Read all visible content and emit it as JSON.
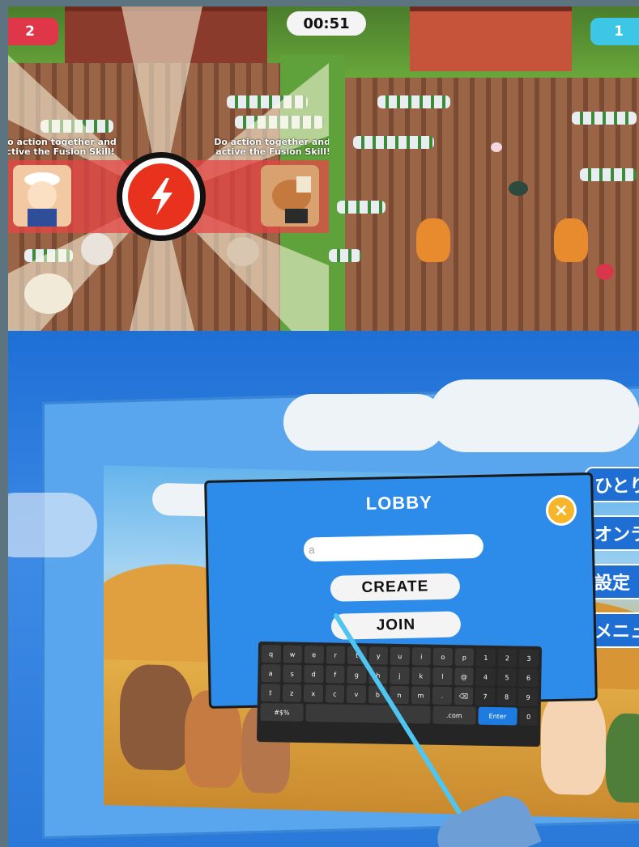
{
  "game": {
    "score_left": "2",
    "score_right": "1",
    "timer": "00:51",
    "fusion_hint_left": "Do action together and active the Fusion Skill!",
    "fusion_hint_right": "Do action together and active the Fusion Skill!",
    "colors": {
      "team_left": "#e0364a",
      "team_right": "#3ec6e6",
      "fusion_button": "#e8321e"
    },
    "icons": [
      "lightning-bolt-icon",
      "fusion-skill-button"
    ]
  },
  "lobby": {
    "title": "LOBBY",
    "room_input_value": "",
    "room_input_placeholder": "a",
    "create_label": "CREATE",
    "join_label": "JOIN",
    "close_icon": "×",
    "side_menu": [
      "ひとりで",
      "オンライン",
      "設定",
      "メニュー"
    ],
    "colors": {
      "panel": "#2d8be9",
      "close": "#f7b52a",
      "enter_key": "#1e7be0"
    }
  },
  "keyboard": {
    "rows": [
      [
        "q",
        "w",
        "e",
        "r",
        "t",
        "y",
        "u",
        "i",
        "o",
        "p",
        "1",
        "2",
        "3"
      ],
      [
        "a",
        "s",
        "d",
        "f",
        "g",
        "h",
        "j",
        "k",
        "l",
        "@",
        "4",
        "5",
        "6"
      ],
      [
        "⇧",
        "z",
        "x",
        "c",
        "v",
        "b",
        "n",
        "m",
        ".",
        "⌫",
        "7",
        "8",
        "9"
      ],
      [
        "#$%",
        "",
        ".com",
        "Enter",
        "0"
      ]
    ]
  }
}
